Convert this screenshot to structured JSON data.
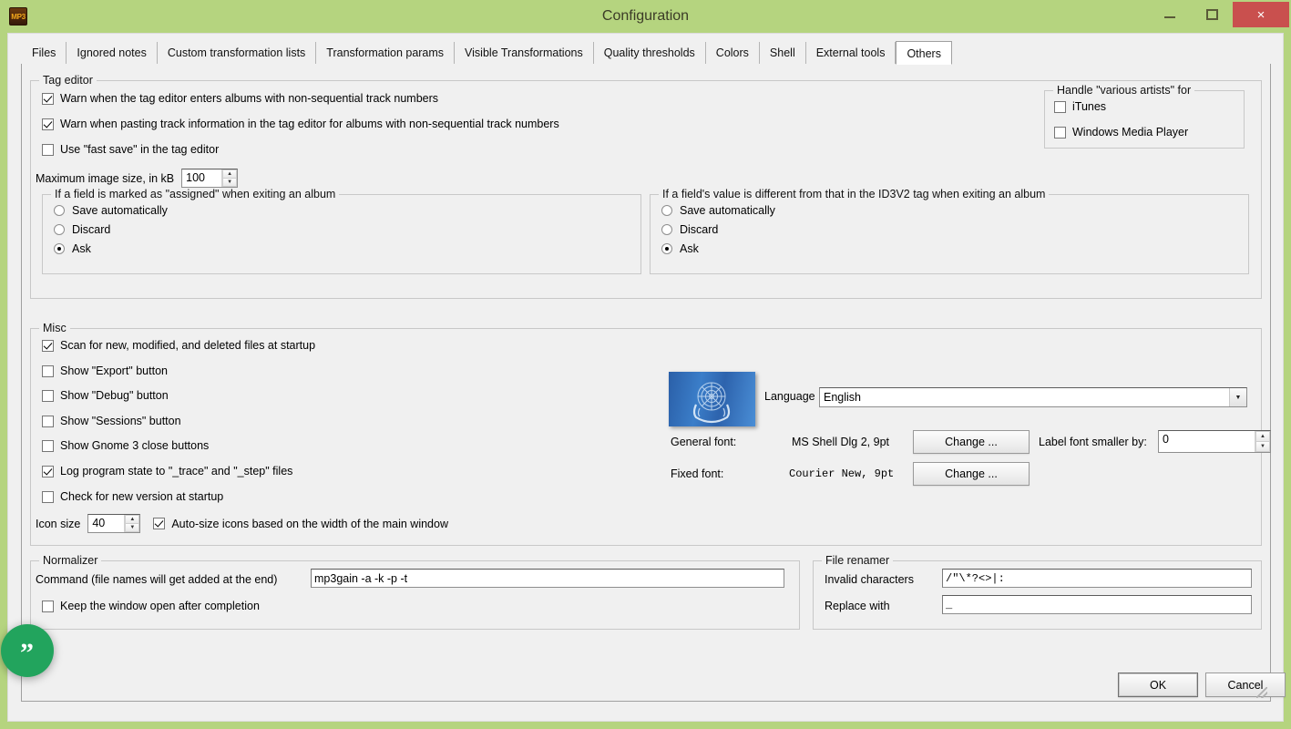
{
  "window": {
    "title": "Configuration",
    "app_icon": "MP3",
    "minimize": "–",
    "maximize": "❐",
    "close": "×",
    "titlebar_color": "#b5d47f",
    "close_color": "#c9504e"
  },
  "tabs": [
    {
      "label": "Files",
      "active": false
    },
    {
      "label": "Ignored notes",
      "active": false
    },
    {
      "label": "Custom transformation lists",
      "active": false
    },
    {
      "label": "Transformation params",
      "active": false
    },
    {
      "label": "Visible Transformations",
      "active": false
    },
    {
      "label": "Quality thresholds",
      "active": false
    },
    {
      "label": "Colors",
      "active": false
    },
    {
      "label": "Shell",
      "active": false
    },
    {
      "label": "External tools",
      "active": false
    },
    {
      "label": "Others",
      "active": true
    }
  ],
  "tag_editor": {
    "title": "Tag editor",
    "checkboxes": [
      {
        "label": "Warn when the tag editor enters albums with non-sequential track numbers",
        "checked": true
      },
      {
        "label": "Warn when pasting track information in the tag editor for albums with non-sequential track numbers",
        "checked": true
      },
      {
        "label": "Use \"fast save\" in the tag editor",
        "checked": false
      }
    ],
    "max_image_label": "Maximum image size, in kB",
    "max_image_value": "100"
  },
  "various_artists": {
    "title": "Handle \"various artists\" for",
    "items": [
      {
        "label": "iTunes",
        "checked": false
      },
      {
        "label": "Windows Media Player",
        "checked": false
      }
    ]
  },
  "assigned_group": {
    "title": "If a field is marked as \"assigned\" when exiting an album",
    "options": [
      {
        "label": "Save automatically",
        "selected": false
      },
      {
        "label": "Discard",
        "selected": false
      },
      {
        "label": "Ask",
        "selected": true
      }
    ]
  },
  "id3v2_group": {
    "title": "If a field's value is different from that in the ID3V2 tag when exiting an album",
    "options": [
      {
        "label": "Save automatically",
        "selected": false
      },
      {
        "label": "Discard",
        "selected": false
      },
      {
        "label": "Ask",
        "selected": true
      }
    ]
  },
  "misc": {
    "title": "Misc",
    "checkboxes": [
      {
        "label": "Scan for new, modified, and deleted files at startup",
        "checked": true
      },
      {
        "label": "Show \"Export\" button",
        "checked": false
      },
      {
        "label": "Show \"Debug\" button",
        "checked": false
      },
      {
        "label": "Show \"Sessions\" button",
        "checked": false
      },
      {
        "label": "Show Gnome 3 close buttons",
        "checked": false
      },
      {
        "label": "Log program state to \"_trace\" and \"_step\" files",
        "checked": true
      },
      {
        "label": "Check for new version at startup",
        "checked": false
      }
    ],
    "icon_size_label": "Icon size",
    "icon_size_value": "40",
    "autosize_label": "Auto-size icons based on the width of the main window",
    "autosize_checked": true,
    "language_label": "Language",
    "language_value": "English",
    "general_font_label": "General font:",
    "general_font_value": "MS Shell Dlg 2, 9pt",
    "general_font_button": "Change ...",
    "fixed_font_label": "Fixed font:",
    "fixed_font_value": "Courier New, 9pt",
    "fixed_font_button": "Change ...",
    "label_smaller_label": "Label font smaller by:",
    "label_smaller_value": "0",
    "flag_icon": "un-flag-icon"
  },
  "normalizer": {
    "title": "Normalizer",
    "command_label": "Command (file names will get added at the end)",
    "command_value": "mp3gain -a -k -p -t",
    "keep_open_label": "Keep the window open after completion",
    "keep_open_checked": false
  },
  "file_renamer": {
    "title": "File renamer",
    "invalid_label": "Invalid characters",
    "invalid_value": "/\"\\*?<>|:",
    "replace_label": "Replace with",
    "replace_value": "_"
  },
  "footer": {
    "ok": "OK",
    "cancel": "Cancel"
  },
  "badge": {
    "name": "quote-badge",
    "glyph": "”",
    "color": "#22a45d"
  }
}
